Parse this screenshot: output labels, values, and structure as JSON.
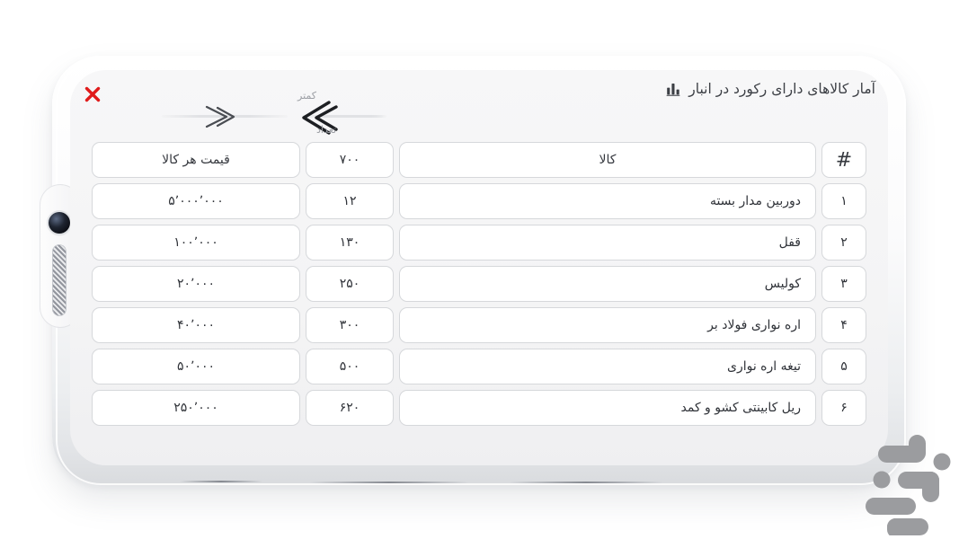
{
  "window": {
    "background_color": "#ffffff"
  },
  "device": {
    "frame_color": "#f2f3f5",
    "screen_color": "#f5f5f6",
    "camera_icon": "front-camera-dot",
    "speaker_icon": "earpiece-speaker-grille"
  },
  "topbar": {
    "close_icon": "close-x-icon",
    "close_color": "#e01b1b",
    "title": "آمار کالاهای دارای رکورد در انبار",
    "title_icon": "stats-chart-icon",
    "title_color": "#3c3f45"
  },
  "annotations": [
    {
      "name": "annotation-arrow-right",
      "glyph": "»",
      "label": ""
    },
    {
      "name": "annotation-arrow-left",
      "glyph": "«",
      "label_top": "کمتر",
      "label_bottom": "تعداد"
    }
  ],
  "table": {
    "headers": {
      "index": "#",
      "item": "کالا",
      "quantity": "۷۰۰",
      "price": "قیمت هر کالا"
    },
    "rows": [
      {
        "index": "۱",
        "item": "دوربین مدار بسته",
        "quantity": "۱۲",
        "price": "۵٬۰۰۰٬۰۰۰"
      },
      {
        "index": "۲",
        "item": "قفل",
        "quantity": "۱۳۰",
        "price": "۱۰۰٬۰۰۰"
      },
      {
        "index": "۳",
        "item": "کولیس",
        "quantity": "۲۵۰",
        "price": "۲۰٬۰۰۰"
      },
      {
        "index": "۴",
        "item": "اره نواری فولاد بر",
        "quantity": "۳۰۰",
        "price": "۴۰٬۰۰۰"
      },
      {
        "index": "۵",
        "item": "تیغه اره نواری",
        "quantity": "۵۰۰",
        "price": "۵۰٬۰۰۰"
      },
      {
        "index": "۶",
        "item": "ریل کابینتی کشو و کمد",
        "quantity": "۶۲۰",
        "price": "۲۵۰٬۰۰۰"
      }
    ]
  },
  "watermark": {
    "name": "bazaar-logo",
    "color": "#9a9b9e"
  }
}
